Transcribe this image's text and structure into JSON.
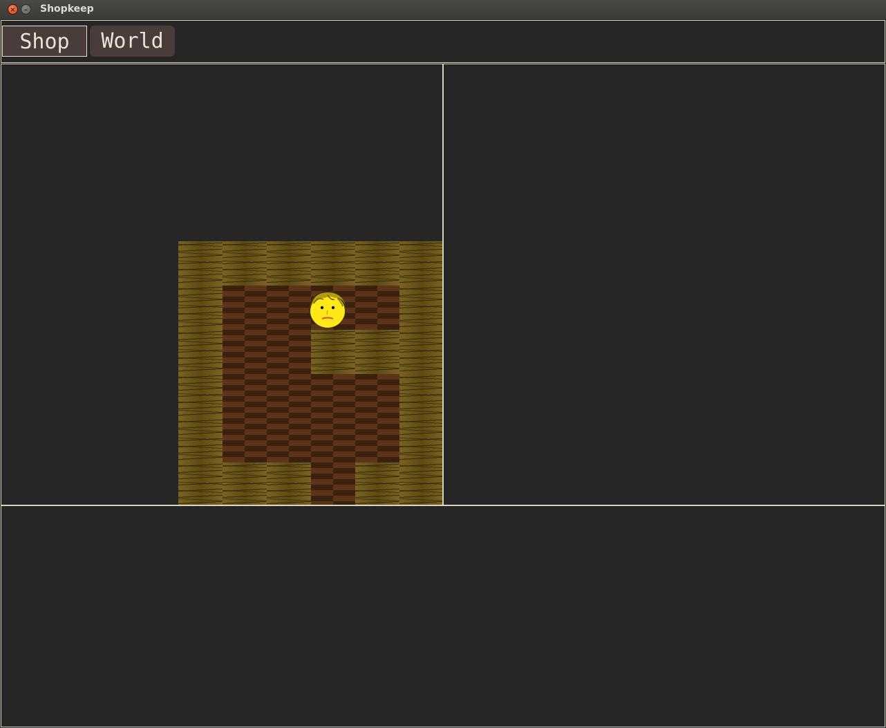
{
  "window": {
    "title": "Shopkeep",
    "close_glyph": "×",
    "minimize_glyph": "–"
  },
  "tabs": [
    {
      "label": "Shop",
      "selected": true
    },
    {
      "label": "World",
      "selected": false
    }
  ],
  "map": {
    "tiles": [
      [
        "wood",
        "wood",
        "wood",
        "wood",
        "wood",
        "wood"
      ],
      [
        "wood",
        "floor",
        "floor",
        "floor",
        "floor",
        "wood"
      ],
      [
        "wood",
        "floor",
        "floor",
        "wood",
        "wood",
        "wood"
      ],
      [
        "wood",
        "floor",
        "floor",
        "floor",
        "floor",
        "wood"
      ],
      [
        "wood",
        "floor",
        "floor",
        "floor",
        "floor",
        "wood"
      ],
      [
        "wood",
        "wood",
        "wood",
        "floor",
        "wood",
        "wood"
      ]
    ],
    "player": {
      "col": 3,
      "row": 1,
      "icon": "player-face-icon"
    }
  },
  "colors": {
    "background": "#262626",
    "panel_border": "#d8d5bf",
    "tab_bg": "#4b3c3c",
    "tab_text": "#e9e4d4",
    "player_face": "#ffe81a"
  }
}
